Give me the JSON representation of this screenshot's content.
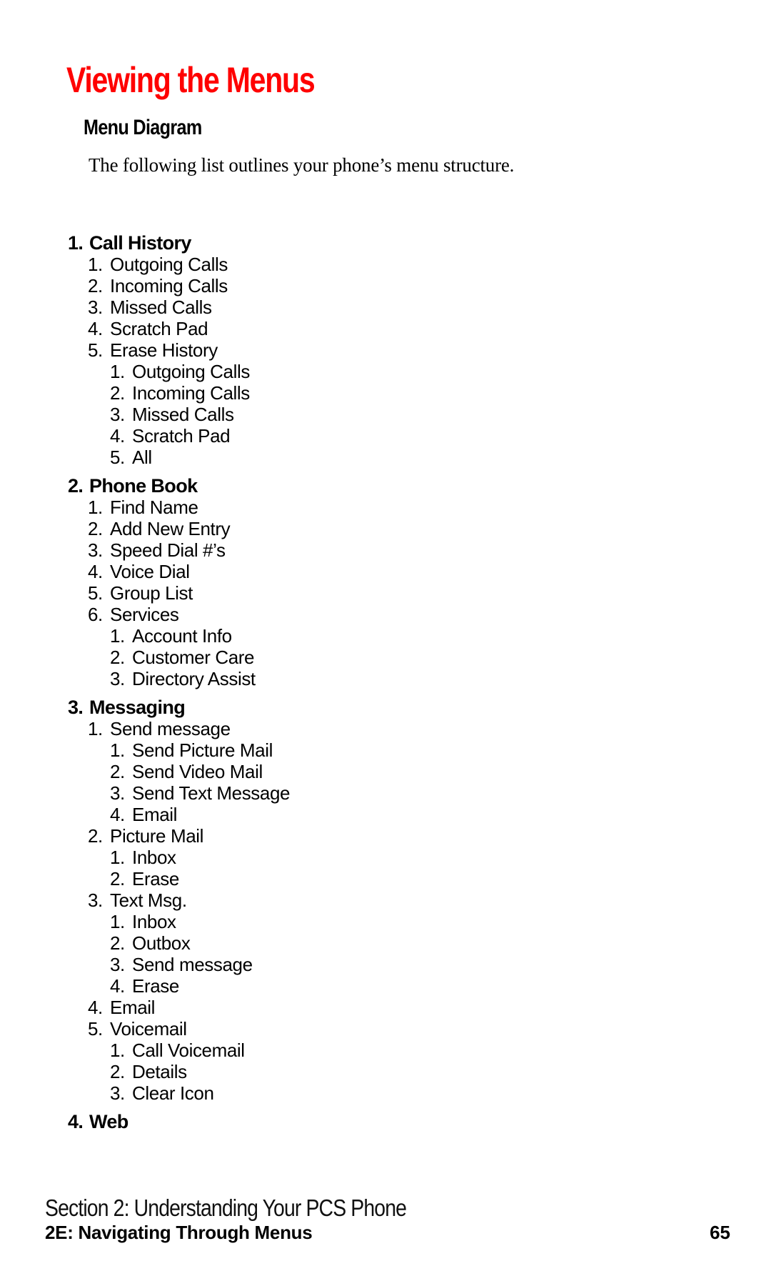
{
  "page": {
    "title": "Viewing the Menus",
    "title_color": "#ff0000",
    "heading": "Menu Diagram",
    "intro": "The following list outlines your phone’s menu structure."
  },
  "menu": [
    {
      "number": "1.",
      "label": "Call History",
      "items": [
        {
          "number": "1.",
          "label": "Outgoing Calls"
        },
        {
          "number": "2.",
          "label": "Incoming Calls"
        },
        {
          "number": "3.",
          "label": "Missed Calls"
        },
        {
          "number": "4.",
          "label": "Scratch Pad"
        },
        {
          "number": "5.",
          "label": "Erase History",
          "items": [
            {
              "number": "1.",
              "label": "Outgoing Calls"
            },
            {
              "number": "2.",
              "label": "Incoming Calls"
            },
            {
              "number": "3.",
              "label": "Missed Calls"
            },
            {
              "number": "4.",
              "label": "Scratch Pad"
            },
            {
              "number": "5.",
              "label": "All"
            }
          ]
        }
      ]
    },
    {
      "number": "2.",
      "label": "Phone Book",
      "items": [
        {
          "number": "1.",
          "label": "Find Name"
        },
        {
          "number": "2.",
          "label": "Add New Entry"
        },
        {
          "number": "3.",
          "label": "Speed Dial #’s"
        },
        {
          "number": "4.",
          "label": "Voice Dial"
        },
        {
          "number": "5.",
          "label": "Group List"
        },
        {
          "number": "6.",
          "label": "Services",
          "items": [
            {
              "number": "1.",
              "label": "Account Info"
            },
            {
              "number": "2.",
              "label": "Customer Care"
            },
            {
              "number": "3.",
              "label": "Directory Assist"
            }
          ]
        }
      ]
    },
    {
      "number": "3.",
      "label": "Messaging",
      "items": [
        {
          "number": "1.",
          "label": "Send message",
          "items": [
            {
              "number": "1.",
              "label": "Send Picture Mail"
            },
            {
              "number": "2.",
              "label": "Send Video Mail"
            },
            {
              "number": "3.",
              "label": "Send Text Message"
            },
            {
              "number": "4.",
              "label": "Email"
            }
          ]
        },
        {
          "number": "2.",
          "label": "Picture Mail",
          "items": [
            {
              "number": "1.",
              "label": "Inbox"
            },
            {
              "number": "2.",
              "label": "Erase"
            }
          ]
        },
        {
          "number": "3.",
          "label": "Text Msg.",
          "items": [
            {
              "number": "1.",
              "label": "Inbox"
            },
            {
              "number": "2.",
              "label": "Outbox"
            },
            {
              "number": "3.",
              "label": "Send message"
            },
            {
              "number": "4.",
              "label": "Erase"
            }
          ]
        },
        {
          "number": "4.",
          "label": "Email"
        },
        {
          "number": "5.",
          "label": "Voicemail",
          "items": [
            {
              "number": "1.",
              "label": "Call Voicemail"
            },
            {
              "number": "2.",
              "label": "Details"
            },
            {
              "number": "3.",
              "label": "Clear Icon"
            }
          ]
        }
      ]
    },
    {
      "number": "4.",
      "label": "Web",
      "items": []
    }
  ],
  "footer": {
    "section": "Section 2: Understanding Your PCS Phone",
    "chapter": "2E: Navigating Through Menus",
    "page_number": "65"
  }
}
